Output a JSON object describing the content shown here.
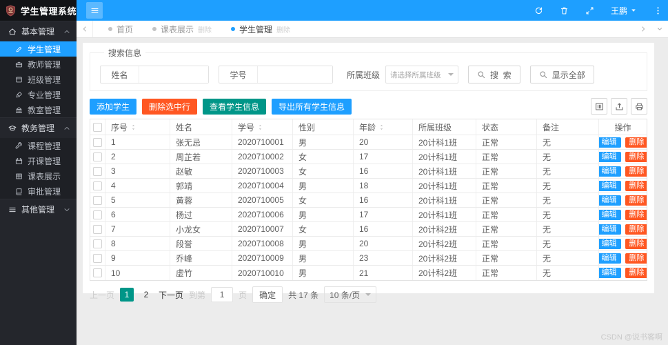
{
  "colors": {
    "accent": "#1E9FFF",
    "danger": "#FF5722",
    "success": "#009688"
  },
  "app": {
    "title": "学生管理系统",
    "user_name": "王鹏"
  },
  "sidebar": {
    "sections": [
      {
        "label": "基本管理",
        "icon": "home-icon",
        "expanded": true,
        "items": [
          {
            "label": "学生管理",
            "icon": "pen-icon",
            "active": true
          },
          {
            "label": "教师管理",
            "icon": "briefcase-icon",
            "active": false
          },
          {
            "label": "班级管理",
            "icon": "window-icon",
            "active": false
          },
          {
            "label": "专业管理",
            "icon": "brush-icon",
            "active": false
          },
          {
            "label": "教室管理",
            "icon": "building-icon",
            "active": false
          }
        ]
      },
      {
        "label": "教务管理",
        "icon": "graduation-cap-icon",
        "expanded": true,
        "items": [
          {
            "label": "课程管理",
            "icon": "wrench-icon",
            "active": false
          },
          {
            "label": "开课管理",
            "icon": "calendar-icon",
            "active": false
          },
          {
            "label": "课表展示",
            "icon": "grid-icon",
            "active": false
          },
          {
            "label": "审批管理",
            "icon": "book-icon",
            "active": false
          }
        ]
      },
      {
        "label": "其他管理",
        "icon": "menu-icon",
        "expanded": false,
        "items": []
      }
    ]
  },
  "tabs": [
    {
      "label": "首页",
      "active": false,
      "close_label": ""
    },
    {
      "label": "课表展示",
      "active": false,
      "close_label": "删除"
    },
    {
      "label": "学生管理",
      "active": true,
      "close_label": "删除"
    }
  ],
  "search": {
    "legend": "搜索信息",
    "name_field": {
      "label": "姓名",
      "value": ""
    },
    "id_field": {
      "label": "学号",
      "value": ""
    },
    "class_field": {
      "label": "所属班级",
      "placeholder": "请选择所属班级"
    },
    "search_button": "搜  索",
    "show_all_button": "显示全部"
  },
  "toolbar": {
    "buttons": [
      {
        "label": "添加学生",
        "color": "#1E9FFF"
      },
      {
        "label": "删除选中行",
        "color": "#FF5722"
      },
      {
        "label": "查看学生信息",
        "color": "#009688"
      },
      {
        "label": "导出所有学生信息",
        "color": "#1E9FFF"
      }
    ],
    "icon_buttons": [
      "columns-filter-icon",
      "export-icon",
      "print-icon"
    ]
  },
  "table": {
    "columns": [
      {
        "label": "序号",
        "sortable": true
      },
      {
        "label": "姓名",
        "sortable": false
      },
      {
        "label": "学号",
        "sortable": true
      },
      {
        "label": "性别",
        "sortable": false
      },
      {
        "label": "年龄",
        "sortable": true
      },
      {
        "label": "所属班级",
        "sortable": false
      },
      {
        "label": "状态",
        "sortable": false
      },
      {
        "label": "备注",
        "sortable": false
      },
      {
        "label": "操作",
        "sortable": false
      }
    ],
    "row_actions": {
      "edit": "编辑",
      "delete": "删除"
    },
    "rows": [
      [
        1,
        "张无忌",
        "2020710001",
        "男",
        20,
        "20计科1班",
        "正常",
        "无"
      ],
      [
        2,
        "周芷若",
        "2020710002",
        "女",
        17,
        "20计科1班",
        "正常",
        "无"
      ],
      [
        3,
        "赵敏",
        "2020710003",
        "女",
        16,
        "20计科1班",
        "正常",
        "无"
      ],
      [
        4,
        "郭靖",
        "2020710004",
        "男",
        18,
        "20计科1班",
        "正常",
        "无"
      ],
      [
        5,
        "黄蓉",
        "2020710005",
        "女",
        16,
        "20计科1班",
        "正常",
        "无"
      ],
      [
        6,
        "杨过",
        "2020710006",
        "男",
        17,
        "20计科1班",
        "正常",
        "无"
      ],
      [
        7,
        "小龙女",
        "2020710007",
        "女",
        16,
        "20计科2班",
        "正常",
        "无"
      ],
      [
        8,
        "段誉",
        "2020710008",
        "男",
        20,
        "20计科2班",
        "正常",
        "无"
      ],
      [
        9,
        "乔峰",
        "2020710009",
        "男",
        23,
        "20计科2班",
        "正常",
        "无"
      ],
      [
        10,
        "虚竹",
        "2020710010",
        "男",
        21,
        "20计科2班",
        "正常",
        "无"
      ]
    ]
  },
  "pagination": {
    "prev": "上一页",
    "pages": [
      {
        "label": "1",
        "active": true
      },
      {
        "label": "2",
        "active": false
      }
    ],
    "next": "下一页",
    "goto_prefix": "到第",
    "goto_value": "1",
    "goto_suffix": "页",
    "confirm": "确定",
    "total": "共 17 条",
    "page_size": "10 条/页"
  },
  "watermark": "CSDN @说书客啊"
}
